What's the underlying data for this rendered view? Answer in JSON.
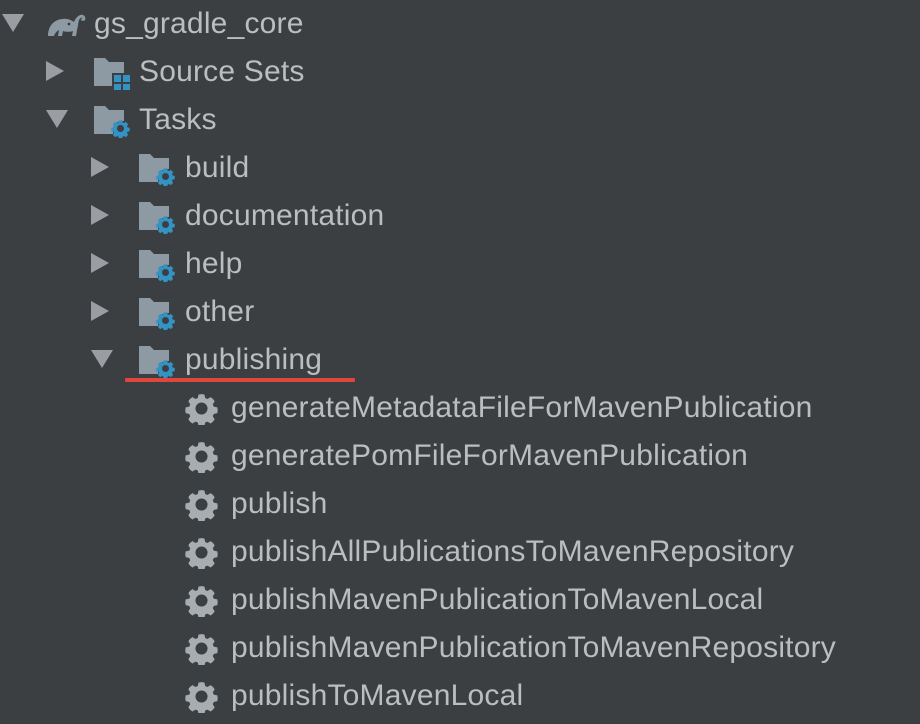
{
  "tree": {
    "root": {
      "label": "gs_gradle_core",
      "icon": "gradle-elephant-icon",
      "expanded": true
    },
    "source_sets": {
      "label": "Source Sets",
      "icon": "source-sets-folder-icon",
      "expanded": false
    },
    "tasks": {
      "label": "Tasks",
      "icon": "task-folder-icon",
      "expanded": true
    },
    "groups": [
      {
        "label": "build",
        "expanded": false
      },
      {
        "label": "documentation",
        "expanded": false
      },
      {
        "label": "help",
        "expanded": false
      },
      {
        "label": "other",
        "expanded": false
      },
      {
        "label": "publishing",
        "expanded": true,
        "highlighted": true
      }
    ],
    "publishing_tasks": [
      "generateMetadataFileForMavenPublication",
      "generatePomFileForMavenPublication",
      "publish",
      "publishAllPublicationsToMavenRepository",
      "publishMavenPublicationToMavenLocal",
      "publishMavenPublicationToMavenRepository",
      "publishToMavenLocal"
    ]
  },
  "colors": {
    "background": "#3c3f41",
    "text": "#bbbdc0",
    "arrow": "#9a9da1",
    "folder": "#8d9aa4",
    "gear_blue": "#3592c4",
    "task_gear": "#a8adb2",
    "highlight_underline": "#e0473c"
  }
}
